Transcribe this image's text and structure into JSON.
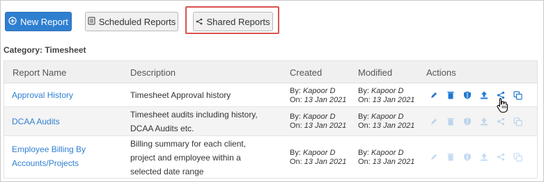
{
  "toolbar": {
    "new_report": "New Report",
    "scheduled_reports": "Scheduled Reports",
    "shared_reports": "Shared Reports"
  },
  "category": "Category: Timesheet",
  "table": {
    "headers": [
      "Report Name",
      "Description",
      "Created",
      "Modified",
      "Actions"
    ],
    "rows": [
      {
        "name": "Approval History",
        "description": "Timesheet Approval history",
        "created_by_label": "By:",
        "created_by": "Kapoor D",
        "created_on_label": "On:",
        "created_on": "13 Jan 2021",
        "modified_by_label": "By:",
        "modified_by": "Kapoor D",
        "modified_on_label": "On:",
        "modified_on": "13 Jan 2021"
      },
      {
        "name": "DCAA Audits",
        "description_line1": "Timesheet audits including history,",
        "description_line2": "DCAA Audits etc.",
        "created_by_label": "By:",
        "created_by": "Kapoor D",
        "created_on_label": "On:",
        "created_on": "13 Jan 2021",
        "modified_by_label": "By:",
        "modified_by": "Kapoor D",
        "modified_on_label": "On:",
        "modified_on": "13 Jan 2021"
      },
      {
        "name_line1": "Employee Billing By",
        "name_line2": "Accounts/Projects",
        "description_line1": "Billing summary for each client,",
        "description_line2": "project and employee within a",
        "description_line3": "selected date range",
        "created_by_label": "By:",
        "created_by": "Kapoor D",
        "created_on_label": "On:",
        "created_on": "13 Jan 2021",
        "modified_by_label": "By:",
        "modified_by": "Kapoor D",
        "modified_on_label": "On:",
        "modified_on": "13 Jan 2021"
      }
    ]
  },
  "colors": {
    "primary": "#2f7fd1",
    "highlight": "#d9534f",
    "action_blue": "#1f78d1"
  },
  "icons": [
    "plus-circle-icon",
    "calendar-icon",
    "share-icon",
    "pencil-icon",
    "trash-icon",
    "shield-icon",
    "upload-icon",
    "share-icon",
    "copy-icon",
    "hand-cursor-icon"
  ]
}
